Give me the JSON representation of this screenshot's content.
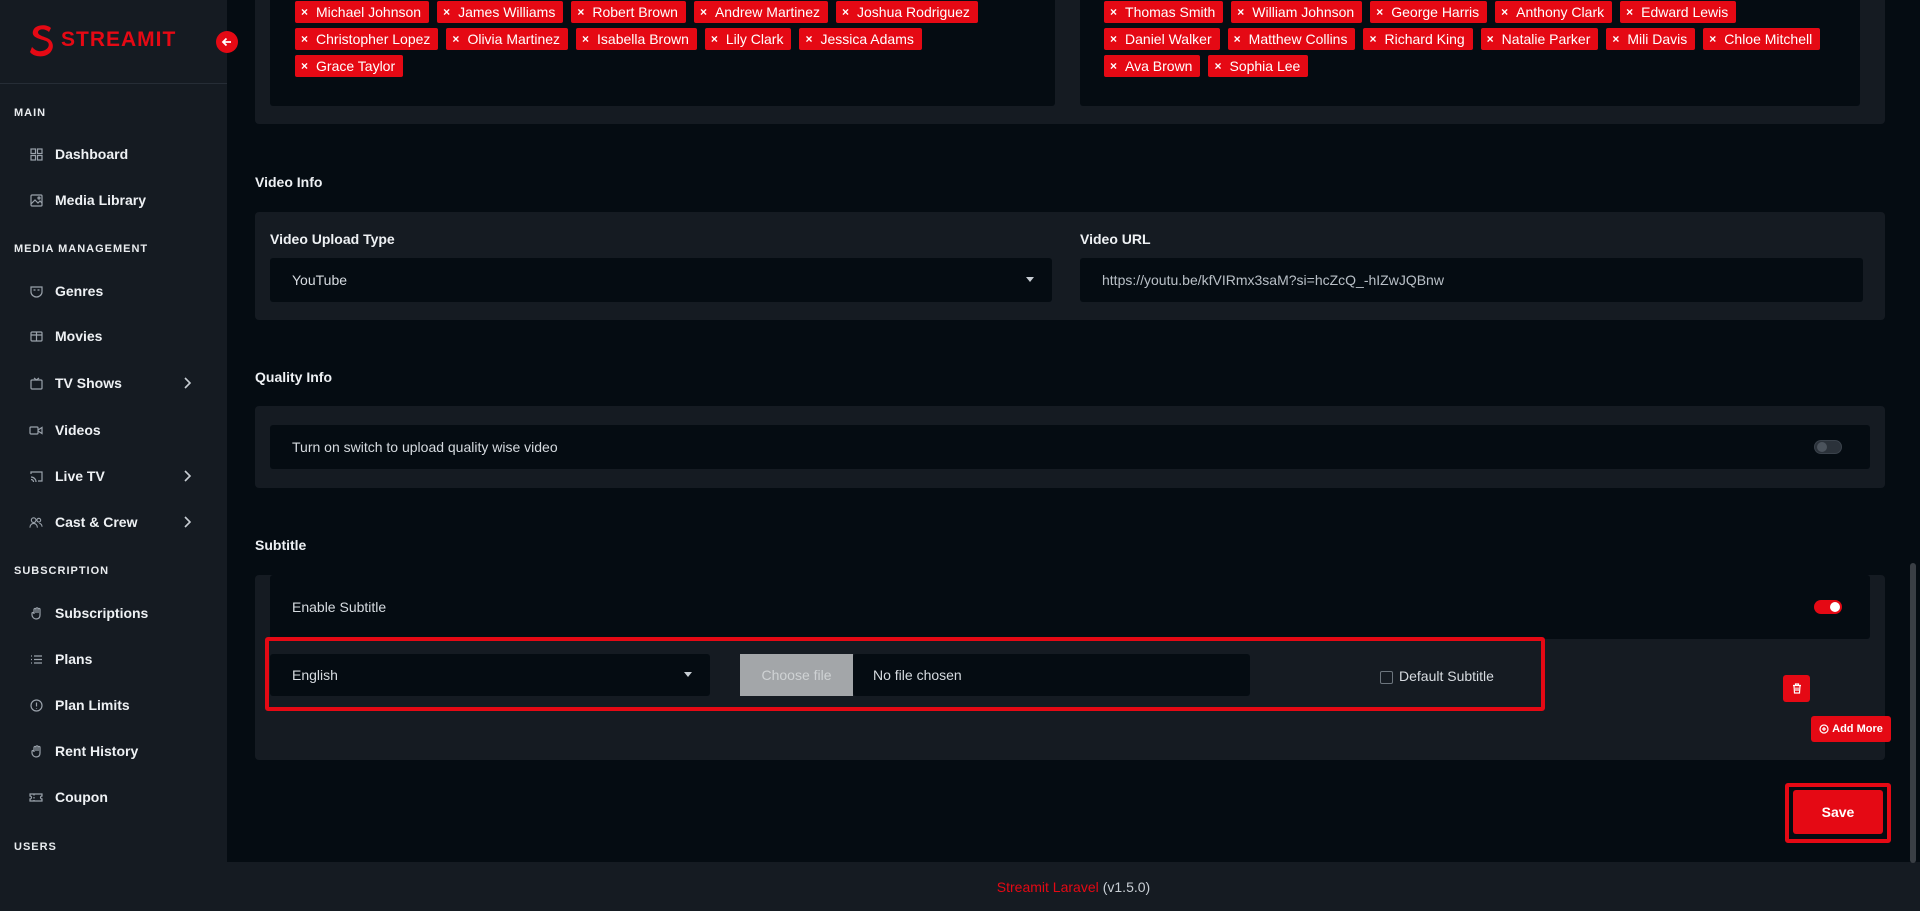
{
  "app": {
    "brand": "STREAMIT"
  },
  "colors": {
    "accent": "#e50914",
    "sidebar_bg": "#151b22",
    "page_bg": "#050c12"
  },
  "sidebar": {
    "sections": [
      {
        "title": "MAIN"
      },
      {
        "title": "MEDIA MANAGEMENT"
      },
      {
        "title": "SUBSCRIPTION"
      },
      {
        "title": "USERS"
      }
    ],
    "items": [
      {
        "label": "Dashboard",
        "icon": "grid-icon"
      },
      {
        "label": "Media Library",
        "icon": "image-icon"
      },
      {
        "label": "Genres",
        "icon": "mask-icon"
      },
      {
        "label": "Movies",
        "icon": "film-icon"
      },
      {
        "label": "TV Shows",
        "icon": "tv-icon"
      },
      {
        "label": "Videos",
        "icon": "video-icon"
      },
      {
        "label": "Live TV",
        "icon": "cast-icon"
      },
      {
        "label": "Cast & Crew",
        "icon": "users-icon"
      },
      {
        "label": "Subscriptions",
        "icon": "hand-icon"
      },
      {
        "label": "Plans",
        "icon": "list-icon"
      },
      {
        "label": "Plan Limits",
        "icon": "info-circle-icon"
      },
      {
        "label": "Rent History",
        "icon": "hand-icon"
      },
      {
        "label": "Coupon",
        "icon": "ticket-icon"
      }
    ]
  },
  "cast": {
    "left": [
      "Michael Johnson",
      "James Williams",
      "Robert Brown",
      "Andrew Martinez",
      "Joshua Rodriguez",
      "Christopher Lopez",
      "Olivia Martinez",
      "Isabella Brown",
      "Lily Clark",
      "Jessica Adams",
      "Grace Taylor"
    ],
    "right": [
      "Thomas Smith",
      "William Johnson",
      "George Harris",
      "Anthony Clark",
      "Edward Lewis",
      "Daniel Walker",
      "Matthew Collins",
      "Richard King",
      "Natalie Parker",
      "Mili Davis",
      "Chloe Mitchell",
      "Ava Brown",
      "Sophia Lee"
    ]
  },
  "video_info": {
    "title": "Video Info",
    "upload_type_label": "Video Upload Type",
    "upload_type_value": "YouTube",
    "url_label": "Video URL",
    "url_value": "https://youtu.be/kfVIRmx3saM?si=hcZcQ_-hIZwJQBnw"
  },
  "quality_info": {
    "title": "Quality Info",
    "switch_label": "Turn on switch to upload quality wise video",
    "switch_on": false
  },
  "subtitle": {
    "title": "Subtitle",
    "enable_label": "Enable Subtitle",
    "enabled": true,
    "language": "English",
    "file_button": "Choose file",
    "file_status": "No file chosen",
    "default_label": "Default Subtitle",
    "default_checked": false,
    "add_more": "Add More"
  },
  "actions": {
    "save": "Save"
  },
  "footer": {
    "brand": "Streamit Laravel",
    "version": "(v1.5.0)"
  }
}
